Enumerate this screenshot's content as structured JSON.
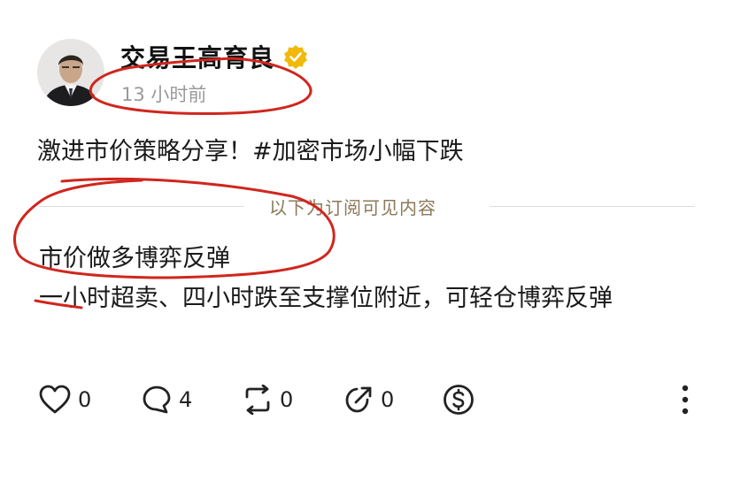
{
  "author": {
    "name": "交易王高育良",
    "verified_badge": "verified-badge-icon",
    "time": "13 小时前"
  },
  "post": {
    "text": "激进市价策略分享！#加密市场小幅下跌",
    "divider_label": "以下为订阅可见内容",
    "locked_title": "市价做多博弈反弹",
    "locked_body": "一小时超卖、四小时跌至支撑位附近，可轻仓博弈反弹"
  },
  "actions": {
    "like": {
      "icon": "heart-icon",
      "count": "0"
    },
    "comment": {
      "icon": "comment-icon",
      "count": "4"
    },
    "repost": {
      "icon": "repost-icon",
      "count": "0"
    },
    "share": {
      "icon": "share-icon",
      "count": "0"
    },
    "tip": {
      "icon": "dollar-icon"
    },
    "more": {
      "icon": "more-vertical-icon"
    }
  },
  "colors": {
    "badge": "#f0b90b",
    "annotation": "#d0261e",
    "divider_text": "#8b7a59"
  }
}
